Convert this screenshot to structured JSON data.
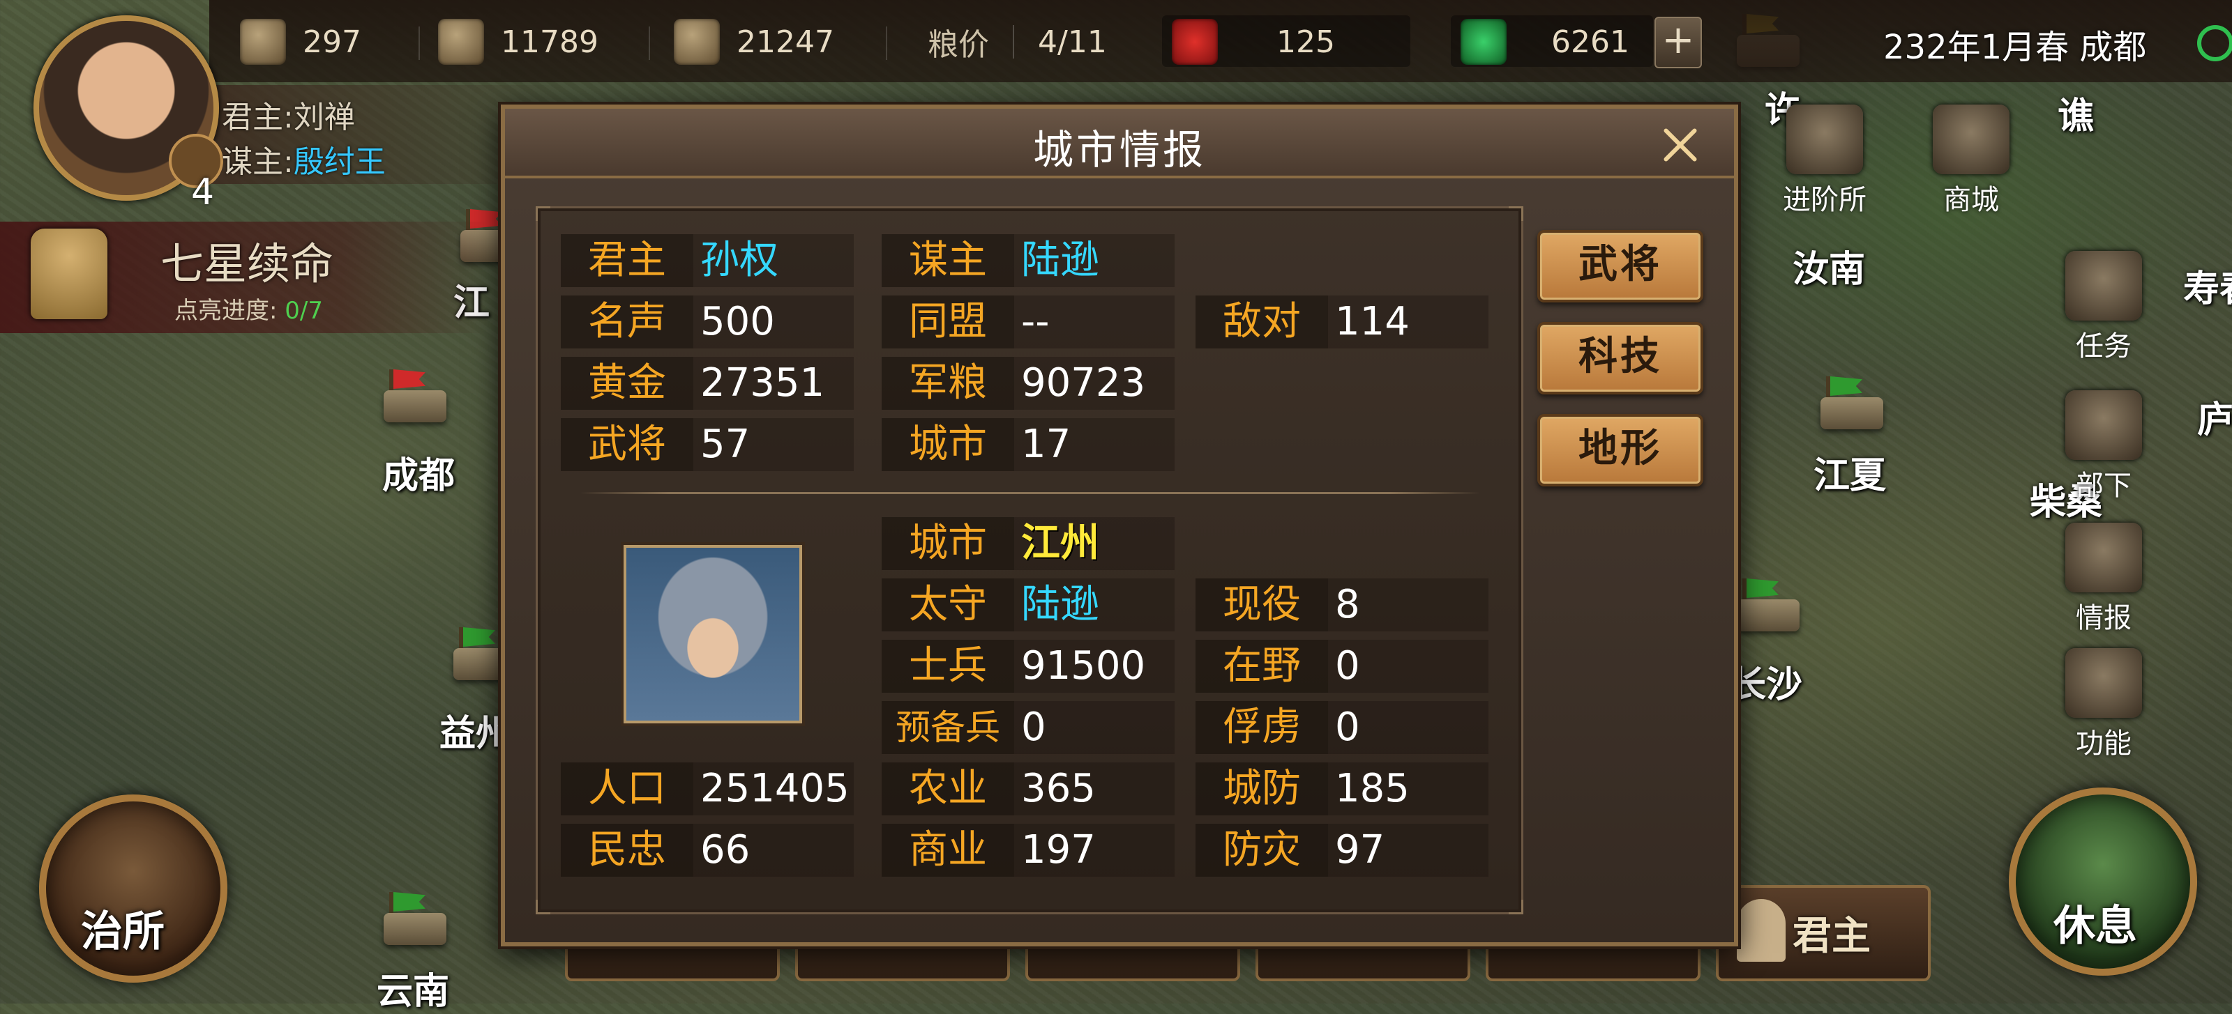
{
  "top_bar": {
    "resources": [
      {
        "icon": "gold-ingot-icon",
        "value": "297"
      },
      {
        "icon": "stone-icon",
        "value": "11789"
      },
      {
        "icon": "wood-icon",
        "value": "21247"
      }
    ],
    "grain_price_label": "粮价",
    "grain_price_value": "4/11",
    "token_value": "125",
    "jade_value": "6261",
    "add_button": "+",
    "date_location": "232年1月春 成都"
  },
  "player": {
    "lord_label": "君主:",
    "lord_name": "刘禅",
    "advisor_label": "谋主:",
    "advisor_name": "殷纣王",
    "avatar_badge_count": "4"
  },
  "seven_stars": {
    "title": "七星续命",
    "progress_label": "点亮进度:",
    "progress_value": "0/7"
  },
  "map_labels": {
    "jiang": "江",
    "chengdu": "成都",
    "yizhou": "益州",
    "yunnan": "云南",
    "xu": "许",
    "qiao": "谯",
    "runan": "汝南",
    "shou": "寿春",
    "jiangxia": "江夏",
    "chaisang": "柴桑",
    "changsha": "长沙",
    "lu": "庐"
  },
  "sidebar": {
    "advance": "进阶所",
    "shop": "商城",
    "quest": "任务",
    "subordinates": "部下",
    "intel": "情报",
    "functions": "功能"
  },
  "left_round_button": "治所",
  "right_round_button": "休息",
  "bottom_tabs": {
    "lord": "君主"
  },
  "dialog": {
    "title": "城市情报",
    "faction": {
      "lord_label": "君主",
      "lord_value": "孙权",
      "advisor_label": "谋主",
      "advisor_value": "陆逊",
      "fame_label": "名声",
      "fame_value": "500",
      "alliance_label": "同盟",
      "alliance_value": "--",
      "hostile_label": "敌对",
      "hostile_value": "114",
      "gold_label": "黄金",
      "gold_value": "27351",
      "food_label": "军粮",
      "food_value": "90723",
      "generals_label": "武将",
      "generals_value": "57",
      "cities_label": "城市",
      "cities_value": "17"
    },
    "city": {
      "city_label": "城市",
      "city_value": "江州",
      "governor_label": "太守",
      "governor_value": "陆逊",
      "active_label": "现役",
      "active_value": "8",
      "soldiers_label": "士兵",
      "soldiers_value": "91500",
      "wild_label": "在野",
      "wild_value": "0",
      "reserve_label": "预备兵",
      "reserve_value": "0",
      "captive_label": "俘虏",
      "captive_value": "0",
      "population_label": "人口",
      "population_value": "251405",
      "agriculture_label": "农业",
      "agriculture_value": "365",
      "defense_label": "城防",
      "defense_value": "185",
      "loyalty_label": "民忠",
      "loyalty_value": "66",
      "commerce_label": "商业",
      "commerce_value": "197",
      "disaster_label": "防灾",
      "disaster_value": "97"
    },
    "buttons": {
      "generals": "武将",
      "tech": "科技",
      "terrain": "地形"
    }
  }
}
